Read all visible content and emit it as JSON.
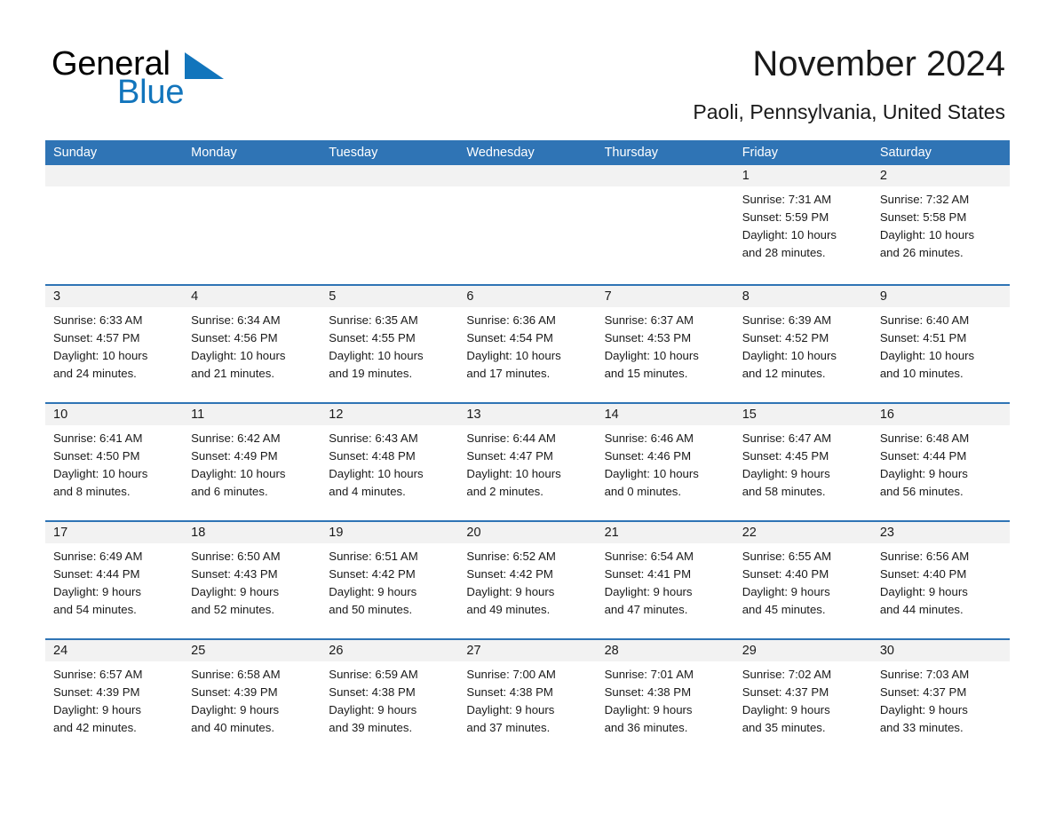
{
  "brand": {
    "name_part1": "General",
    "name_part2": "Blue",
    "flag_icon": "blue-triangle-flag-icon",
    "accent_color": "#1275bc"
  },
  "header": {
    "title": "November 2024",
    "location": "Paoli, Pennsylvania, United States"
  },
  "theme": {
    "header_bar_color": "#2f74b5",
    "day_band_color": "#f2f2f2",
    "row_divider_color": "#2f74b5",
    "text_color": "#1a1a1a"
  },
  "calendar": {
    "weekday_headers": [
      "Sunday",
      "Monday",
      "Tuesday",
      "Wednesday",
      "Thursday",
      "Friday",
      "Saturday"
    ],
    "weeks": [
      [
        {
          "day": "",
          "empty": true
        },
        {
          "day": "",
          "empty": true
        },
        {
          "day": "",
          "empty": true
        },
        {
          "day": "",
          "empty": true
        },
        {
          "day": "",
          "empty": true
        },
        {
          "day": "1",
          "sunrise": "Sunrise: 7:31 AM",
          "sunset": "Sunset: 5:59 PM",
          "daylight_line1": "Daylight: 10 hours",
          "daylight_line2": "and 28 minutes."
        },
        {
          "day": "2",
          "sunrise": "Sunrise: 7:32 AM",
          "sunset": "Sunset: 5:58 PM",
          "daylight_line1": "Daylight: 10 hours",
          "daylight_line2": "and 26 minutes."
        }
      ],
      [
        {
          "day": "3",
          "sunrise": "Sunrise: 6:33 AM",
          "sunset": "Sunset: 4:57 PM",
          "daylight_line1": "Daylight: 10 hours",
          "daylight_line2": "and 24 minutes."
        },
        {
          "day": "4",
          "sunrise": "Sunrise: 6:34 AM",
          "sunset": "Sunset: 4:56 PM",
          "daylight_line1": "Daylight: 10 hours",
          "daylight_line2": "and 21 minutes."
        },
        {
          "day": "5",
          "sunrise": "Sunrise: 6:35 AM",
          "sunset": "Sunset: 4:55 PM",
          "daylight_line1": "Daylight: 10 hours",
          "daylight_line2": "and 19 minutes."
        },
        {
          "day": "6",
          "sunrise": "Sunrise: 6:36 AM",
          "sunset": "Sunset: 4:54 PM",
          "daylight_line1": "Daylight: 10 hours",
          "daylight_line2": "and 17 minutes."
        },
        {
          "day": "7",
          "sunrise": "Sunrise: 6:37 AM",
          "sunset": "Sunset: 4:53 PM",
          "daylight_line1": "Daylight: 10 hours",
          "daylight_line2": "and 15 minutes."
        },
        {
          "day": "8",
          "sunrise": "Sunrise: 6:39 AM",
          "sunset": "Sunset: 4:52 PM",
          "daylight_line1": "Daylight: 10 hours",
          "daylight_line2": "and 12 minutes."
        },
        {
          "day": "9",
          "sunrise": "Sunrise: 6:40 AM",
          "sunset": "Sunset: 4:51 PM",
          "daylight_line1": "Daylight: 10 hours",
          "daylight_line2": "and 10 minutes."
        }
      ],
      [
        {
          "day": "10",
          "sunrise": "Sunrise: 6:41 AM",
          "sunset": "Sunset: 4:50 PM",
          "daylight_line1": "Daylight: 10 hours",
          "daylight_line2": "and 8 minutes."
        },
        {
          "day": "11",
          "sunrise": "Sunrise: 6:42 AM",
          "sunset": "Sunset: 4:49 PM",
          "daylight_line1": "Daylight: 10 hours",
          "daylight_line2": "and 6 minutes."
        },
        {
          "day": "12",
          "sunrise": "Sunrise: 6:43 AM",
          "sunset": "Sunset: 4:48 PM",
          "daylight_line1": "Daylight: 10 hours",
          "daylight_line2": "and 4 minutes."
        },
        {
          "day": "13",
          "sunrise": "Sunrise: 6:44 AM",
          "sunset": "Sunset: 4:47 PM",
          "daylight_line1": "Daylight: 10 hours",
          "daylight_line2": "and 2 minutes."
        },
        {
          "day": "14",
          "sunrise": "Sunrise: 6:46 AM",
          "sunset": "Sunset: 4:46 PM",
          "daylight_line1": "Daylight: 10 hours",
          "daylight_line2": "and 0 minutes."
        },
        {
          "day": "15",
          "sunrise": "Sunrise: 6:47 AM",
          "sunset": "Sunset: 4:45 PM",
          "daylight_line1": "Daylight: 9 hours",
          "daylight_line2": "and 58 minutes."
        },
        {
          "day": "16",
          "sunrise": "Sunrise: 6:48 AM",
          "sunset": "Sunset: 4:44 PM",
          "daylight_line1": "Daylight: 9 hours",
          "daylight_line2": "and 56 minutes."
        }
      ],
      [
        {
          "day": "17",
          "sunrise": "Sunrise: 6:49 AM",
          "sunset": "Sunset: 4:44 PM",
          "daylight_line1": "Daylight: 9 hours",
          "daylight_line2": "and 54 minutes."
        },
        {
          "day": "18",
          "sunrise": "Sunrise: 6:50 AM",
          "sunset": "Sunset: 4:43 PM",
          "daylight_line1": "Daylight: 9 hours",
          "daylight_line2": "and 52 minutes."
        },
        {
          "day": "19",
          "sunrise": "Sunrise: 6:51 AM",
          "sunset": "Sunset: 4:42 PM",
          "daylight_line1": "Daylight: 9 hours",
          "daylight_line2": "and 50 minutes."
        },
        {
          "day": "20",
          "sunrise": "Sunrise: 6:52 AM",
          "sunset": "Sunset: 4:42 PM",
          "daylight_line1": "Daylight: 9 hours",
          "daylight_line2": "and 49 minutes."
        },
        {
          "day": "21",
          "sunrise": "Sunrise: 6:54 AM",
          "sunset": "Sunset: 4:41 PM",
          "daylight_line1": "Daylight: 9 hours",
          "daylight_line2": "and 47 minutes."
        },
        {
          "day": "22",
          "sunrise": "Sunrise: 6:55 AM",
          "sunset": "Sunset: 4:40 PM",
          "daylight_line1": "Daylight: 9 hours",
          "daylight_line2": "and 45 minutes."
        },
        {
          "day": "23",
          "sunrise": "Sunrise: 6:56 AM",
          "sunset": "Sunset: 4:40 PM",
          "daylight_line1": "Daylight: 9 hours",
          "daylight_line2": "and 44 minutes."
        }
      ],
      [
        {
          "day": "24",
          "sunrise": "Sunrise: 6:57 AM",
          "sunset": "Sunset: 4:39 PM",
          "daylight_line1": "Daylight: 9 hours",
          "daylight_line2": "and 42 minutes."
        },
        {
          "day": "25",
          "sunrise": "Sunrise: 6:58 AM",
          "sunset": "Sunset: 4:39 PM",
          "daylight_line1": "Daylight: 9 hours",
          "daylight_line2": "and 40 minutes."
        },
        {
          "day": "26",
          "sunrise": "Sunrise: 6:59 AM",
          "sunset": "Sunset: 4:38 PM",
          "daylight_line1": "Daylight: 9 hours",
          "daylight_line2": "and 39 minutes."
        },
        {
          "day": "27",
          "sunrise": "Sunrise: 7:00 AM",
          "sunset": "Sunset: 4:38 PM",
          "daylight_line1": "Daylight: 9 hours",
          "daylight_line2": "and 37 minutes."
        },
        {
          "day": "28",
          "sunrise": "Sunrise: 7:01 AM",
          "sunset": "Sunset: 4:38 PM",
          "daylight_line1": "Daylight: 9 hours",
          "daylight_line2": "and 36 minutes."
        },
        {
          "day": "29",
          "sunrise": "Sunrise: 7:02 AM",
          "sunset": "Sunset: 4:37 PM",
          "daylight_line1": "Daylight: 9 hours",
          "daylight_line2": "and 35 minutes."
        },
        {
          "day": "30",
          "sunrise": "Sunrise: 7:03 AM",
          "sunset": "Sunset: 4:37 PM",
          "daylight_line1": "Daylight: 9 hours",
          "daylight_line2": "and 33 minutes."
        }
      ]
    ]
  }
}
